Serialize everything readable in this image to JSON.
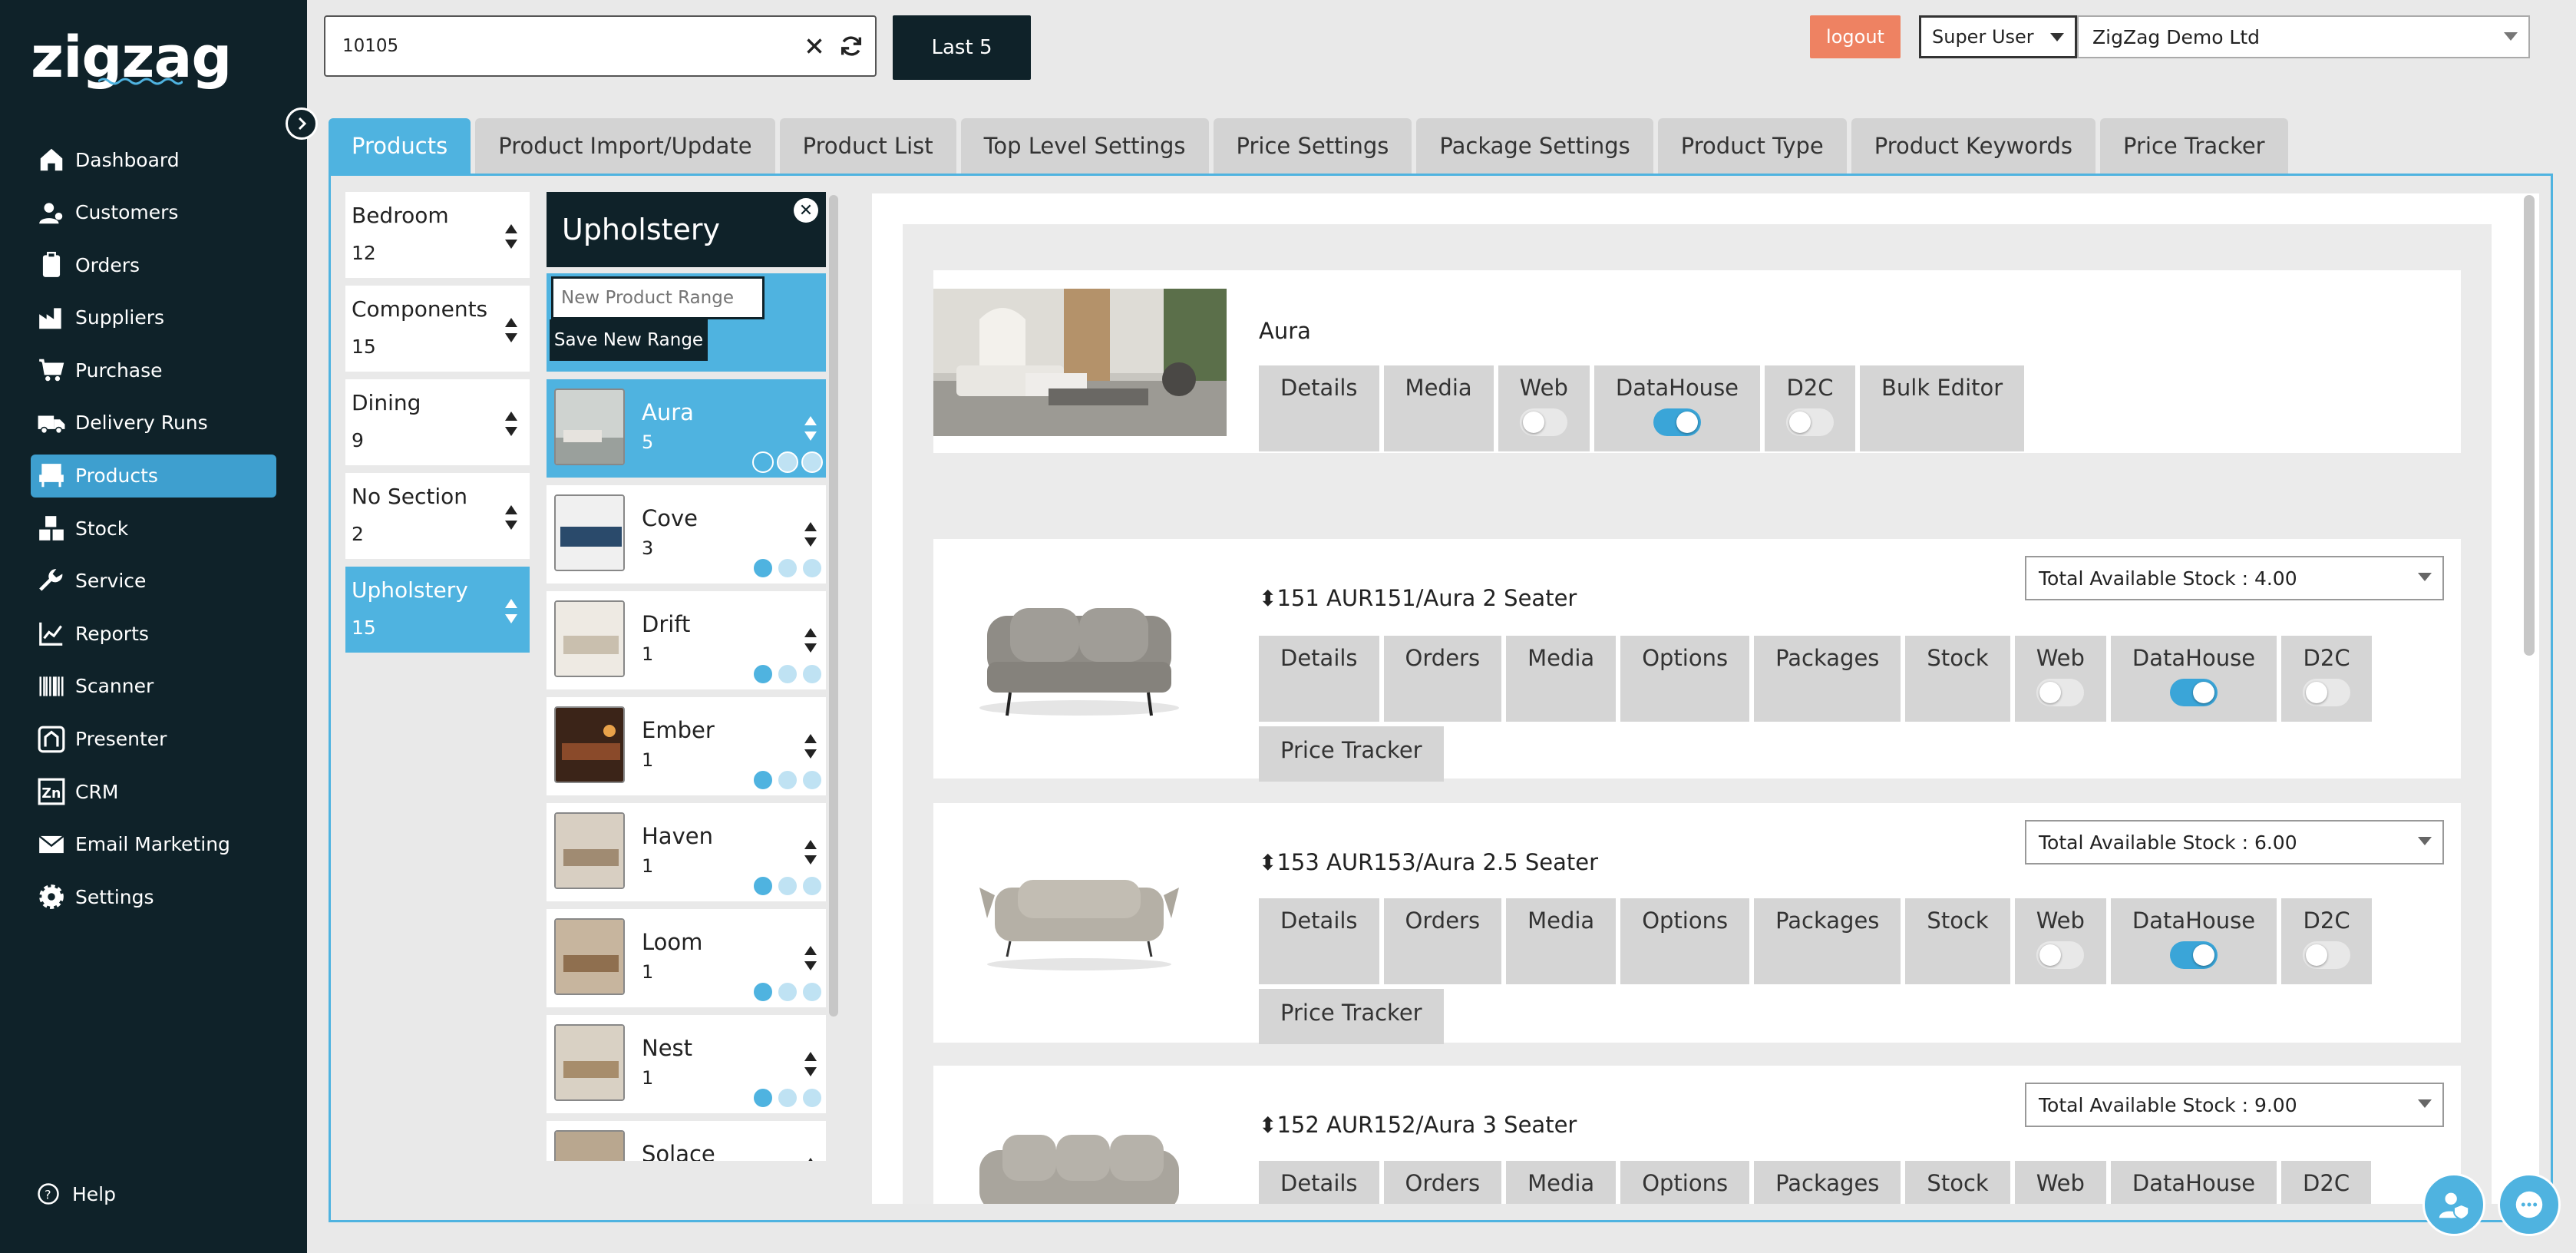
{
  "brand": "zigzag",
  "nav": [
    {
      "label": "Dashboard",
      "icon": "home-icon"
    },
    {
      "label": "Customers",
      "icon": "users-icon"
    },
    {
      "label": "Orders",
      "icon": "clipboard-icon"
    },
    {
      "label": "Suppliers",
      "icon": "factory-icon"
    },
    {
      "label": "Purchase",
      "icon": "cart-icon"
    },
    {
      "label": "Delivery Runs",
      "icon": "truck-icon"
    },
    {
      "label": "Products",
      "icon": "chair-icon",
      "active": true
    },
    {
      "label": "Stock",
      "icon": "boxes-icon"
    },
    {
      "label": "Service",
      "icon": "wrench-icon"
    },
    {
      "label": "Reports",
      "icon": "chart-line-icon"
    },
    {
      "label": "Scanner",
      "icon": "barcode-icon"
    },
    {
      "label": "Presenter",
      "icon": "presenter-icon"
    },
    {
      "label": "CRM",
      "icon": "crm-icon"
    },
    {
      "label": "Email Marketing",
      "icon": "envelope-icon"
    },
    {
      "label": "Settings",
      "icon": "gear-icon"
    }
  ],
  "help_label": "Help",
  "search": {
    "value": "10105"
  },
  "last5_label": "Last 5",
  "logout_label": "logout",
  "user_role": "Super User",
  "company": "ZigZag Demo Ltd",
  "tabs": [
    "Products",
    "Product Import/Update",
    "Product List",
    "Top Level Settings",
    "Price Settings",
    "Package Settings",
    "Product Type",
    "Product Keywords",
    "Price Tracker"
  ],
  "sections": [
    {
      "name": "Bedroom",
      "count": "12"
    },
    {
      "name": "Components",
      "count": "15"
    },
    {
      "name": "Dining",
      "count": "9"
    },
    {
      "name": "No Section",
      "count": "2"
    },
    {
      "name": "Upholstery",
      "count": "15",
      "active": true
    }
  ],
  "ranges_header": "Upholstery",
  "new_range_placeholder": "New Product Range",
  "save_range_label": "Save New Range",
  "ranges": [
    {
      "name": "Aura",
      "count": "5",
      "active": true
    },
    {
      "name": "Cove",
      "count": "3"
    },
    {
      "name": "Drift",
      "count": "1"
    },
    {
      "name": "Ember",
      "count": "1"
    },
    {
      "name": "Haven",
      "count": "1"
    },
    {
      "name": "Loom",
      "count": "1"
    },
    {
      "name": "Nest",
      "count": "1"
    },
    {
      "name": "Solace",
      "count": ""
    }
  ],
  "range_card": {
    "title": "Aura",
    "buttons": [
      "Details",
      "Media",
      "Web",
      "DataHouse",
      "D2C",
      "Bulk Editor"
    ]
  },
  "products": [
    {
      "title": "151 AUR151/Aura 2 Seater",
      "stock": "Total Available Stock : 4.00"
    },
    {
      "title": "153 AUR153/Aura 2.5 Seater",
      "stock": "Total Available Stock : 6.00"
    },
    {
      "title": "152 AUR152/Aura 3 Seater",
      "stock": "Total Available Stock : 9.00"
    }
  ],
  "product_buttons": [
    "Details",
    "Orders",
    "Media",
    "Options",
    "Packages",
    "Stock",
    "Web",
    "DataHouse",
    "D2C",
    "Price Tracker"
  ],
  "colors": {
    "sidebar": "#0f2229",
    "accent": "#4fb3e0",
    "logout": "#ee8262"
  }
}
